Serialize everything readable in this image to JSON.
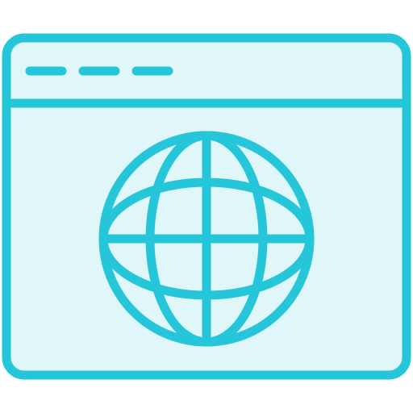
{
  "icon": {
    "name": "browser-globe-icon",
    "colors": {
      "stroke": "#26C6DA",
      "fill": "#E0F7FA"
    },
    "window_controls": [
      "dash-1",
      "dash-2",
      "dash-3"
    ]
  }
}
